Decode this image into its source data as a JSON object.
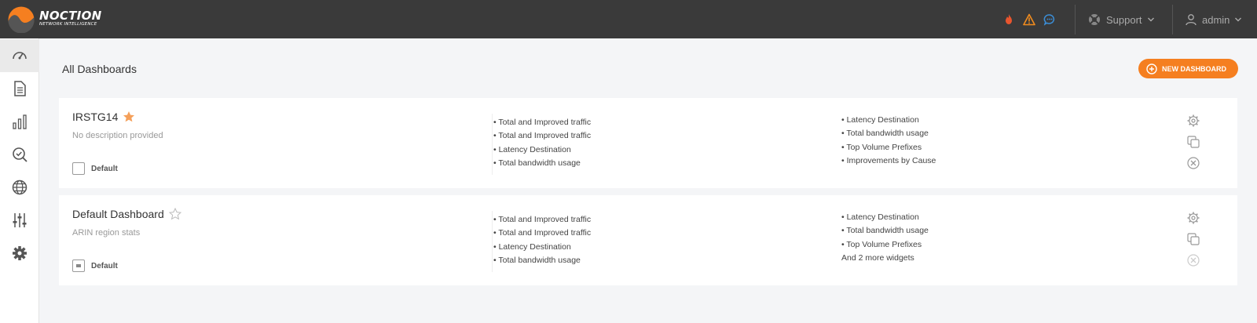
{
  "brand": {
    "name": "NOCTION",
    "tagline": "NETWORK INTELLIGENCE"
  },
  "topbar": {
    "icons": [
      "fire-icon",
      "warning-icon",
      "chat-icon"
    ],
    "support_label": "Support",
    "user_label": "admin",
    "colors": {
      "fire": "#e8552e",
      "warning": "#f28c1e",
      "chat": "#3b8fd9"
    }
  },
  "sidebar": {
    "items": [
      {
        "icon": "dashboard-gauge-icon",
        "active": true
      },
      {
        "icon": "document-icon"
      },
      {
        "icon": "bar-chart-icon"
      },
      {
        "icon": "search-check-icon"
      },
      {
        "icon": "globe-icon"
      },
      {
        "icon": "sliders-icon"
      },
      {
        "icon": "settings-gear-icon"
      }
    ]
  },
  "page": {
    "title": "All Dashboards",
    "new_button_label": "NEW DASHBOARD",
    "accent": "#f57f20"
  },
  "dashboards": [
    {
      "name": "IRSTG14",
      "favorite": true,
      "description": "No description provided",
      "default_label": "Default",
      "default_checked": false,
      "widgets_col1": [
        "• Total and Improved traffic",
        "• Total and Improved traffic",
        "• Latency Destination",
        "• Total bandwidth usage"
      ],
      "widgets_col2": [
        "• Latency Destination",
        "• Total bandwidth usage",
        "• Top Volume Prefixes",
        "• Improvements by Cause"
      ]
    },
    {
      "name": "Default Dashboard",
      "favorite": false,
      "description": "ARIN region stats",
      "default_label": "Default",
      "default_checked": "indeterminate",
      "widgets_col1": [
        "• Total and Improved traffic",
        "• Total and Improved traffic",
        "• Latency Destination",
        "• Total bandwidth usage"
      ],
      "widgets_col2": [
        "• Latency Destination",
        "• Total bandwidth usage",
        "• Top Volume Prefixes",
        "And 2 more widgets"
      ]
    }
  ]
}
